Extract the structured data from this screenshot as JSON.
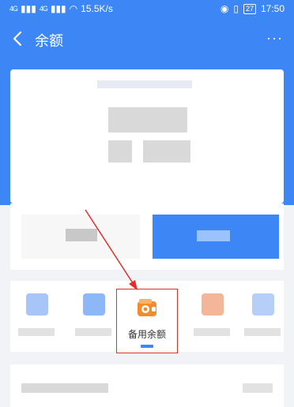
{
  "status_bar": {
    "signal_1": "4G",
    "signal_2": "4G",
    "speed": "15.5K/s",
    "battery": "27",
    "time": "17:50"
  },
  "nav": {
    "title": "余额",
    "more": "···"
  },
  "menu": {
    "highlight_label": "备用余额"
  },
  "colors": {
    "primary_blue": "#3d86f5",
    "highlight_red": "#e0302c",
    "wallet_orange": "#f28c2b"
  }
}
